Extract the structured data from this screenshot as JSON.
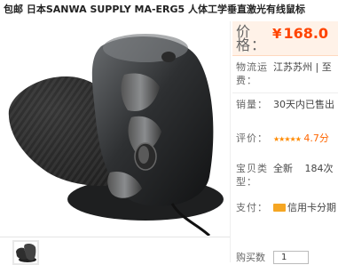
{
  "product": {
    "title": "包邮 日本SANWA SUPPLY MA-ERG5 人体工学垂直激光有线鼠标"
  },
  "details": {
    "price_label": "价格：",
    "price_currency": "¥",
    "price_value": "168.0",
    "shipping_label": "物流运费：",
    "shipping_value": "江苏苏州 | 至",
    "sales_label": "销量：",
    "sales_value": "30天内已售出",
    "rating_label": "评价：",
    "rating_stars": "★★★★★",
    "rating_value": "4.7分",
    "type_label": "宝贝类型：",
    "type_value": "全新",
    "type_count": "184次",
    "payment_label": "支付：",
    "payment_value": "信用卡分期",
    "quantity_label": "购买数",
    "quantity_value": "1"
  },
  "icons": {
    "payment": "credit-card-icon"
  },
  "colors": {
    "price": "#ff4400",
    "price_background": "#fff2e8",
    "stars": "#ff8a00"
  }
}
